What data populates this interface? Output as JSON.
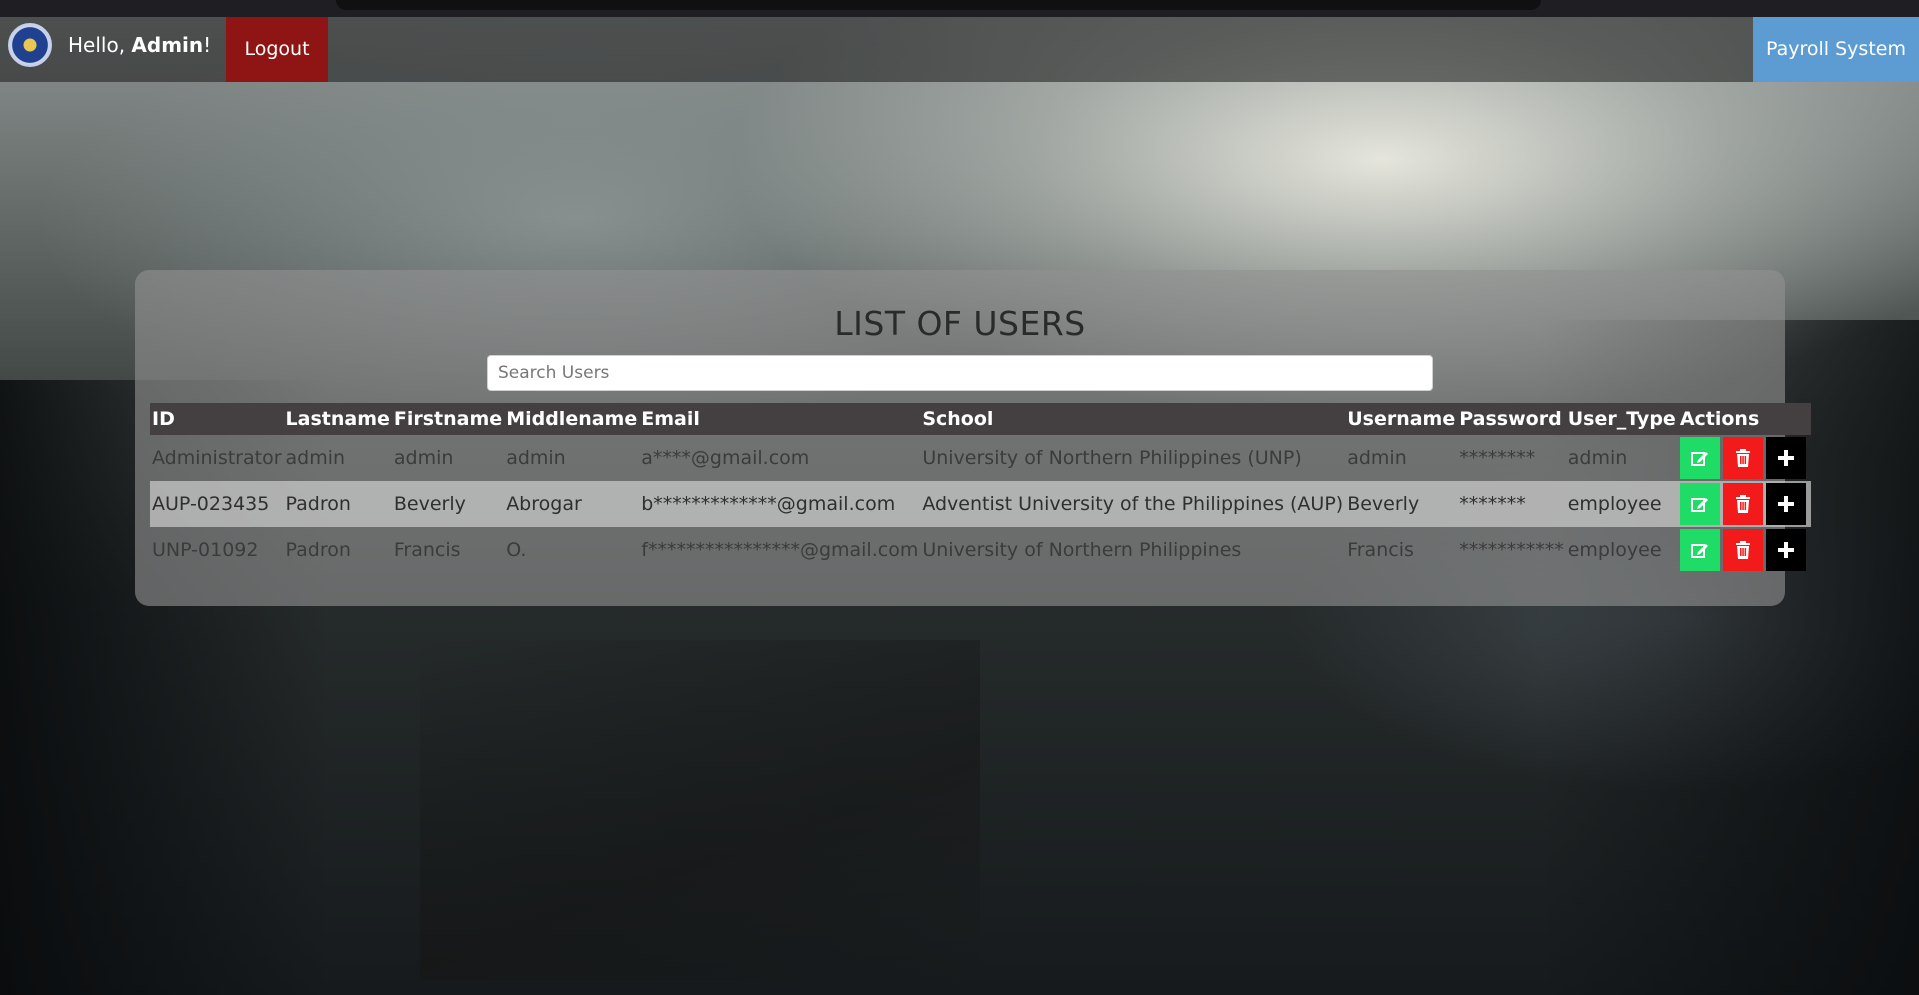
{
  "navbar": {
    "greeting_prefix": "Hello, ",
    "username": "Admin",
    "greeting_suffix": "!",
    "logout_label": "Logout",
    "payroll_label": "Payroll System",
    "colors": {
      "logout_bg": "#8f1515",
      "payroll_bg": "#5c9cd2"
    }
  },
  "main": {
    "title": "LIST OF USERS",
    "search_placeholder": "Search Users",
    "columns": [
      "ID",
      "Lastname",
      "Firstname",
      "Middlename",
      "Email",
      "School",
      "Username",
      "Password",
      "User_Type",
      "Actions"
    ],
    "rows": [
      {
        "id": "Administrator",
        "lastname": "admin",
        "firstname": "admin",
        "middlename": "admin",
        "email": "a****@gmail.com",
        "school": "University of Northern Philippines (UNP)",
        "username": "admin",
        "password": "********",
        "user_type": "admin"
      },
      {
        "id": "AUP-023435",
        "lastname": "Padron",
        "firstname": "Beverly",
        "middlename": "Abrogar",
        "email": "b*************@gmail.com",
        "school": "Adventist University of the Philippines (AUP)",
        "username": "Beverly",
        "password": "*******",
        "user_type": "employee"
      },
      {
        "id": "UNP-01092",
        "lastname": "Padron",
        "firstname": "Francis",
        "middlename": "O.",
        "email": "f****************@gmail.com",
        "school": "University of Northern Philippines",
        "username": "Francis",
        "password": "***********",
        "user_type": "employee"
      }
    ],
    "action_icons": [
      "edit-icon",
      "trash-icon",
      "plus-icon"
    ],
    "action_colors": {
      "edit": "#1fdc66",
      "delete": "#f21a1a",
      "add": "#000000"
    }
  }
}
